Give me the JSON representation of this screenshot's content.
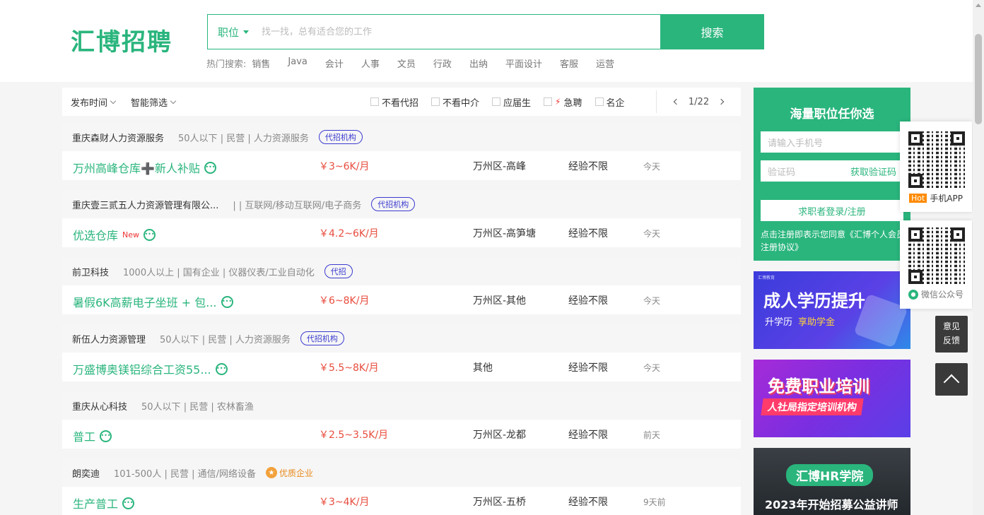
{
  "logo": "汇博招聘",
  "search": {
    "type_label": "职位",
    "placeholder": "找一找，总有适合您的工作",
    "button": "搜索"
  },
  "hot_search": {
    "label": "热门搜索:",
    "keywords": [
      "销售",
      "Java",
      "会计",
      "人事",
      "文员",
      "行政",
      "出纳",
      "平面设计",
      "客服",
      "运营"
    ]
  },
  "filters": {
    "publish_time": "发布时间",
    "smart_filter": "智能筛选",
    "checks": [
      "不看代招",
      "不看中介",
      "应届生",
      "急聘",
      "名企"
    ],
    "pager": "1/22"
  },
  "jobs": [
    {
      "company": "重庆森财人力资源服务",
      "info": "50人以下 | 民营 | 人力资源服务",
      "tag": "代招机构",
      "title": "万州高峰仓库➕新人补贴",
      "new": "",
      "salary": "￥3~6K/月",
      "location": "万州区-高峰",
      "experience": "经验不限",
      "date": "今天"
    },
    {
      "company": "重庆壹三贰五人力资源管理有限公...",
      "info": "| | 互联网/移动互联网/电子商务",
      "tag": "代招机构",
      "title": "优选仓库",
      "new": "New",
      "salary": "￥4.2~6K/月",
      "location": "万州区-高笋塘",
      "experience": "经验不限",
      "date": "今天"
    },
    {
      "company": "前卫科技",
      "info": "1000人以上 | 国有企业 | 仪器仪表/工业自动化",
      "tag": "代招",
      "title": "暑假6K高薪电子坐班 + 包...",
      "new": "",
      "salary": "￥6~8K/月",
      "location": "万州区-其他",
      "experience": "经验不限",
      "date": "今天"
    },
    {
      "company": "新伍人力资源管理",
      "info": "50人以下 | 民营 | 人力资源服务",
      "tag": "代招机构",
      "title": "万盛博奥镁铝综合工资55...",
      "new": "",
      "salary": "￥5.5~8K/月",
      "location": "其他",
      "experience": "经验不限",
      "date": "今天"
    },
    {
      "company": "重庆从心科技",
      "info": "50人以下 | 民营 | 农林畜渔",
      "tag": "",
      "title": "普工",
      "new": "",
      "salary": "￥2.5~3.5K/月",
      "location": "万州区-龙都",
      "experience": "经验不限",
      "date": "前天"
    },
    {
      "company": "朗奕迪",
      "info": "101-500人 | 民营 | 通信/网络设备",
      "tag": "",
      "quality": "优质企业",
      "title": "生产普工",
      "new": "",
      "salary": "￥3~4K/月",
      "location": "万州区-五桥",
      "experience": "经验不限",
      "date": "9天前"
    }
  ],
  "login_panel": {
    "title": "海量职位任你选",
    "phone_placeholder": "请输入手机号",
    "code_placeholder": "验证码",
    "get_code": "获取验证码",
    "login_button": "求职者登录/注册",
    "note": "点击注册即表示您同意《汇博个人会员注册协议》"
  },
  "banners": {
    "b1_tiny": "汇博教育",
    "b1_title": "成人学历提升",
    "b1_sub1": "升学历",
    "b1_sub2": "享助学金",
    "b2_title": "免费职业培训",
    "b2_sub": "人社局指定培训机构",
    "b3_title": "汇博HR学院",
    "b3_sub": "2023年开始招募公益讲师"
  },
  "float": {
    "app_hot": "Hot",
    "app_label": "手机APP",
    "wechat_label": "微信公众号",
    "feedback_line1": "意见",
    "feedback_line2": "反馈"
  },
  "colors": {
    "brand": "#2ab57d",
    "salary": "#e84c3d",
    "tag": "#3b3bd0"
  }
}
